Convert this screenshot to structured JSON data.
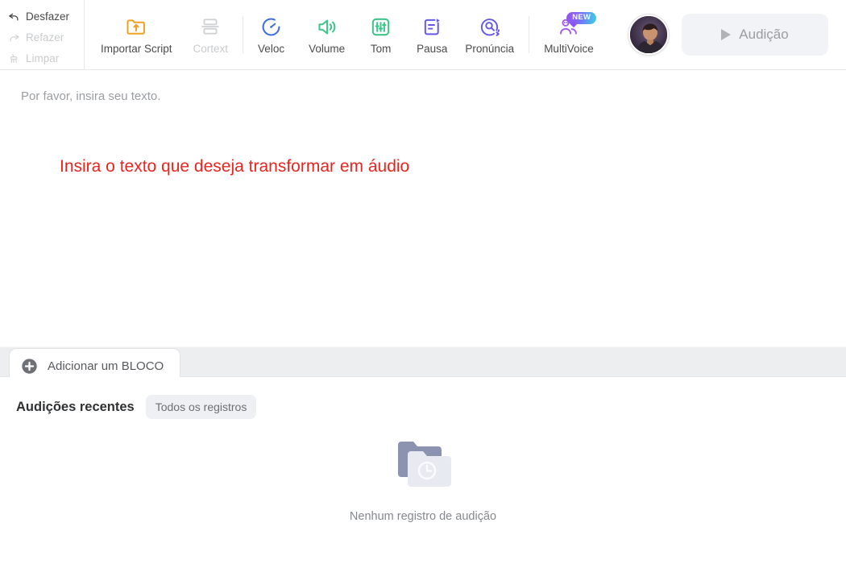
{
  "header": {
    "history": [
      {
        "label": "Desfazer",
        "icon": "undo-arrow-icon",
        "disabled": false
      },
      {
        "label": "Refazer",
        "icon": "redo-arrow-icon",
        "disabled": true
      },
      {
        "label": "Limpar",
        "icon": "broom-icon",
        "disabled": true
      }
    ],
    "tools": [
      {
        "label": "Importar Script",
        "icon": "folder-upload-icon",
        "color": "#f0a020",
        "disabled": false
      },
      {
        "label": "Cortext",
        "icon": "split-text-icon",
        "color": "#c9cbcd",
        "disabled": true
      },
      {
        "label": "Veloc",
        "icon": "speed-gauge-icon",
        "color": "#3f6fe0",
        "disabled": false
      },
      {
        "label": "Volume",
        "icon": "speaker-icon",
        "color": "#3fc58a",
        "disabled": false
      },
      {
        "label": "Tom",
        "icon": "equalizer-icon",
        "color": "#3fc58a",
        "disabled": false
      },
      {
        "label": "Pausa",
        "icon": "pause-insert-icon",
        "color": "#6457e8",
        "disabled": false
      },
      {
        "label": "Pronúncia",
        "icon": "pronunciation-icon",
        "color": "#6457e8",
        "disabled": false
      },
      {
        "label": "MultiVoice",
        "icon": "multivoice-users-icon",
        "color": "#a05ce8",
        "disabled": false,
        "badge": "NEW"
      }
    ],
    "avatar_name": "user-avatar",
    "play_button": "Audição"
  },
  "editor": {
    "placeholder": "Por favor, insira seu texto.",
    "annotation": "Insira o texto que deseja transformar em áudio",
    "annotation_color": "#e8251f",
    "add_block_label": "Adicionar um BLOCO"
  },
  "recent": {
    "title": "Audições recentes",
    "all_records_chip": "Todos os registros",
    "empty_text": "Nenhum registro de audição",
    "empty_icon": "folder-clock-icon"
  }
}
